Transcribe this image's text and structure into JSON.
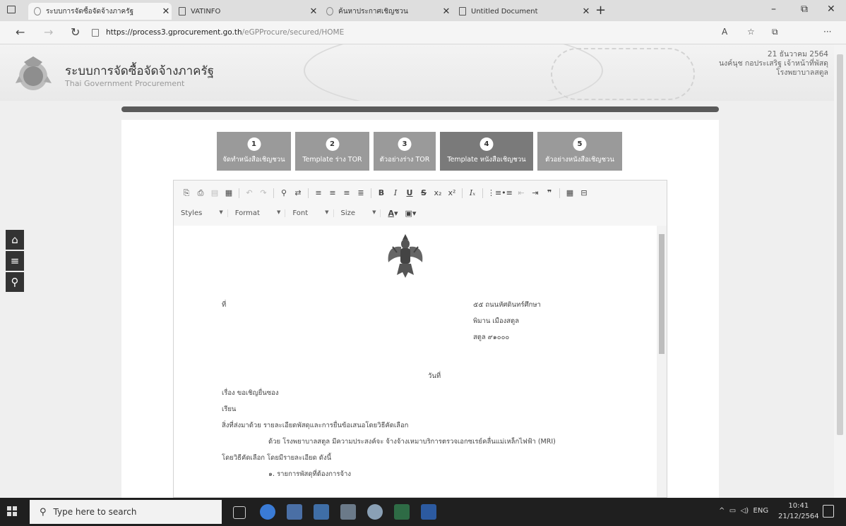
{
  "browser": {
    "tabs": [
      {
        "title": "ระบบการจัดซื้อจัดจ้างภาครัฐ",
        "active": true
      },
      {
        "title": "VATINFO",
        "active": false
      },
      {
        "title": "ค้นหาประกาศเชิญชวน",
        "active": false
      },
      {
        "title": "Untitled Document",
        "active": false
      }
    ],
    "url_host": "https://process3.gprocurement.go.th",
    "url_path": "/eGPProcure/secured/HOME"
  },
  "site": {
    "title": "ระบบการจัดซื้อจัดจ้างภาครัฐ",
    "subtitle": "Thai Government Procurement",
    "date": "21 ธันวาคม 2564",
    "user": "นงค์นุช กอประเสริฐ เจ้าหน้าที่พัสดุ",
    "org": "โรงพยาบาลสตูล"
  },
  "steps": [
    {
      "num": "1",
      "label": "จัดทำหนังสือเชิญชวน"
    },
    {
      "num": "2",
      "label": "Template ร่าง TOR"
    },
    {
      "num": "3",
      "label": "ตัวอย่างร่าง TOR"
    },
    {
      "num": "4",
      "label": "Template หนังสือเชิญชวน"
    },
    {
      "num": "5",
      "label": "ตัวอย่างหนังสือเชิญชวน"
    }
  ],
  "editor": {
    "styles": "Styles",
    "format": "Format",
    "font": "Font",
    "size": "Size"
  },
  "letter": {
    "ref_label": "ที่",
    "address1": "๕๕ ถนนหัศดินทร์ศึกษา",
    "address2": "พิมาน เมืองสตูล",
    "address3": "สตูล ๙๑๐๐๐",
    "date_label": "วันที่",
    "subject": "เรื่อง ขอเชิญยื่นซอง",
    "to": "เรียน",
    "attachment": "สิ่งที่ส่งมาด้วย รายละเอียดพัสดุและการยื่นข้อเสนอโดยวิธีคัดเลือก",
    "body1": "ด้วย โรงพยาบาลสตูล มีความประสงค์จะ จ้างจ้างเหมาบริการตรวจเอกซเรย์คลื่นแม่เหล็กไฟฟ้า (MRI)",
    "body2": "โดยวิธีคัดเลือก โดยมีรายละเอียด ดังนี้",
    "item1": "๑. รายการพัสดุที่ต้องการจ้าง"
  },
  "taskbar": {
    "search_placeholder": "Type here to search",
    "lang": "ENG",
    "time": "10:41",
    "date": "21/12/2564"
  },
  "colors": {
    "step_bg": "#9a9a9a",
    "step_active_bg": "#7a7a7a",
    "dark_bar": "#5a5a5a",
    "taskbar": "#1f1f1f"
  }
}
